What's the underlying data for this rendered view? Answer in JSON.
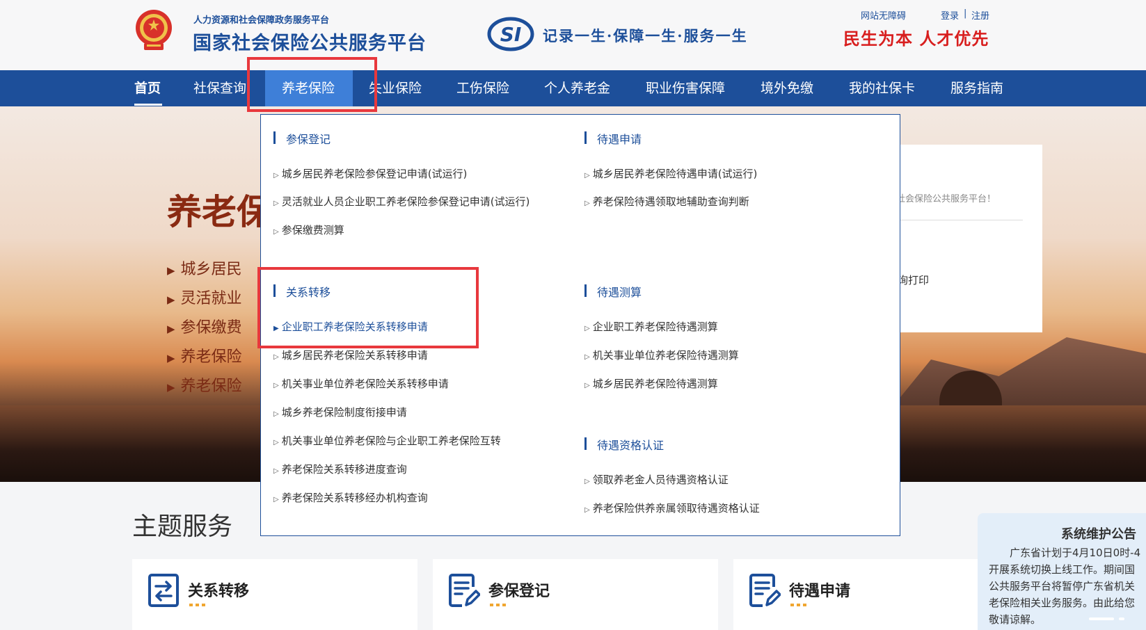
{
  "header": {
    "platform_subtitle": "人力资源和社会保障政务服务平台",
    "platform_title": "国家社会保险公共服务平台",
    "slogan": "记录一生·保障一生·服务一生",
    "accessibility_link": "网站无障碍",
    "login_link": "登录",
    "separator": "|",
    "register_link": "注册",
    "motto": "民生为本 人才优先"
  },
  "nav": {
    "items": [
      {
        "label": "首页"
      },
      {
        "label": "社保查询"
      },
      {
        "label": "养老保险"
      },
      {
        "label": "失业保险"
      },
      {
        "label": "工伤保险"
      },
      {
        "label": "个人养老金"
      },
      {
        "label": "职业伤害保障"
      },
      {
        "label": "境外免缴"
      },
      {
        "label": "我的社保卡"
      },
      {
        "label": "服务指南"
      }
    ],
    "active_index": 2
  },
  "hero": {
    "title": "养老保",
    "items": [
      "城乡居民",
      "灵活就业",
      "参保缴费",
      "养老保险",
      "养老保险"
    ]
  },
  "login_panel": {
    "welcome_fragment": "社会保险公共服务平台！",
    "print_fragment": "询打印"
  },
  "dropdown": {
    "sections": [
      {
        "title": "参保登记",
        "links": [
          "城乡居民养老保险参保登记申请(试运行)",
          "灵活就业人员企业职工养老保险参保登记申请(试运行)",
          "参保缴费测算"
        ]
      },
      {
        "title": "待遇申请",
        "links": [
          "城乡居民养老保险待遇申请(试运行)",
          "养老保险待遇领取地辅助查询判断"
        ]
      },
      {
        "title": "关系转移",
        "links": [
          "企业职工养老保险关系转移申请",
          "城乡居民养老保险关系转移申请",
          "机关事业单位养老保险关系转移申请",
          "城乡养老保险制度衔接申请",
          "机关事业单位养老保险与企业职工养老保险互转",
          "养老保险关系转移进度查询",
          "养老保险关系转移经办机构查询"
        ]
      },
      {
        "title": "待遇测算",
        "links": [
          "企业职工养老保险待遇测算",
          "机关事业单位养老保险待遇测算",
          "城乡居民养老保险待遇测算"
        ]
      },
      {
        "title": "待遇资格认证",
        "links": [
          "领取养老金人员待遇资格认证",
          "养老保险供养亲属领取待遇资格认证"
        ]
      }
    ]
  },
  "themes": {
    "title": "主题服务",
    "cards": [
      {
        "label": "关系转移",
        "icon": "transfer-icon"
      },
      {
        "label": "参保登记",
        "icon": "document-edit-icon"
      },
      {
        "label": "待遇申请",
        "icon": "document-edit-icon"
      }
    ]
  },
  "notice": {
    "title": "系统维护公告",
    "lines": [
      "广东省计划于4月10日0时-4",
      "开展系统切换上线工作。期间国",
      "公共服务平台将暂停广东省机关",
      "老保险相关业务服务。由此给您",
      "敬请谅解。"
    ]
  },
  "colors": {
    "brand_blue": "#1d4f9a",
    "nav_active": "#3e7fd8",
    "highlight_red": "#e8383d",
    "motto_red": "#d81e1e",
    "dots_orange": "#f0a630"
  }
}
